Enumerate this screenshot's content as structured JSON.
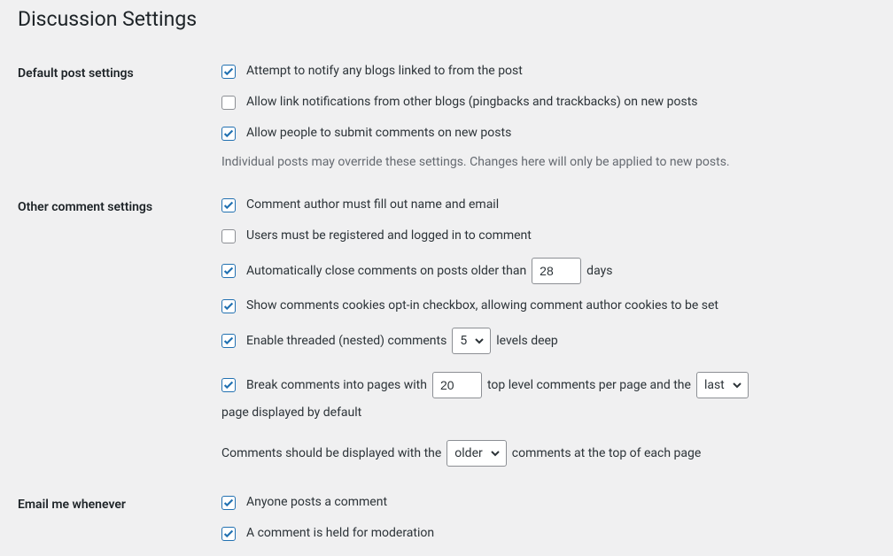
{
  "page_title": "Discussion Settings",
  "sections": {
    "default_post": {
      "heading": "Default post settings",
      "notify_blogs": {
        "checked": true,
        "label": "Attempt to notify any blogs linked to from the post"
      },
      "allow_pingbacks": {
        "checked": false,
        "label": "Allow link notifications from other blogs (pingbacks and trackbacks) on new posts"
      },
      "allow_comments": {
        "checked": true,
        "label": "Allow people to submit comments on new posts"
      },
      "note": "Individual posts may override these settings. Changes here will only be applied to new posts."
    },
    "other_comment": {
      "heading": "Other comment settings",
      "require_name_email": {
        "checked": true,
        "label": "Comment author must fill out name and email"
      },
      "require_registration": {
        "checked": false,
        "label": "Users must be registered and logged in to comment"
      },
      "auto_close": {
        "checked": true,
        "label_before": "Automatically close comments on posts older than",
        "days": "28",
        "label_after": "days"
      },
      "cookies_optin": {
        "checked": true,
        "label": "Show comments cookies opt-in checkbox, allowing comment author cookies to be set"
      },
      "threaded": {
        "checked": true,
        "label_before": "Enable threaded (nested) comments",
        "levels": "5",
        "label_after": "levels deep"
      },
      "paginate": {
        "checked": true,
        "label_before": "Break comments into pages with",
        "per_page": "20",
        "label_mid": "top level comments per page and the",
        "page_default": "last",
        "label_after": "page displayed by default"
      },
      "order": {
        "label_before": "Comments should be displayed with the",
        "order": "older",
        "label_after": "comments at the top of each page"
      }
    },
    "email_me": {
      "heading": "Email me whenever",
      "anyone_posts": {
        "checked": true,
        "label": "Anyone posts a comment"
      },
      "held_moderation": {
        "checked": true,
        "label": "A comment is held for moderation"
      }
    }
  }
}
